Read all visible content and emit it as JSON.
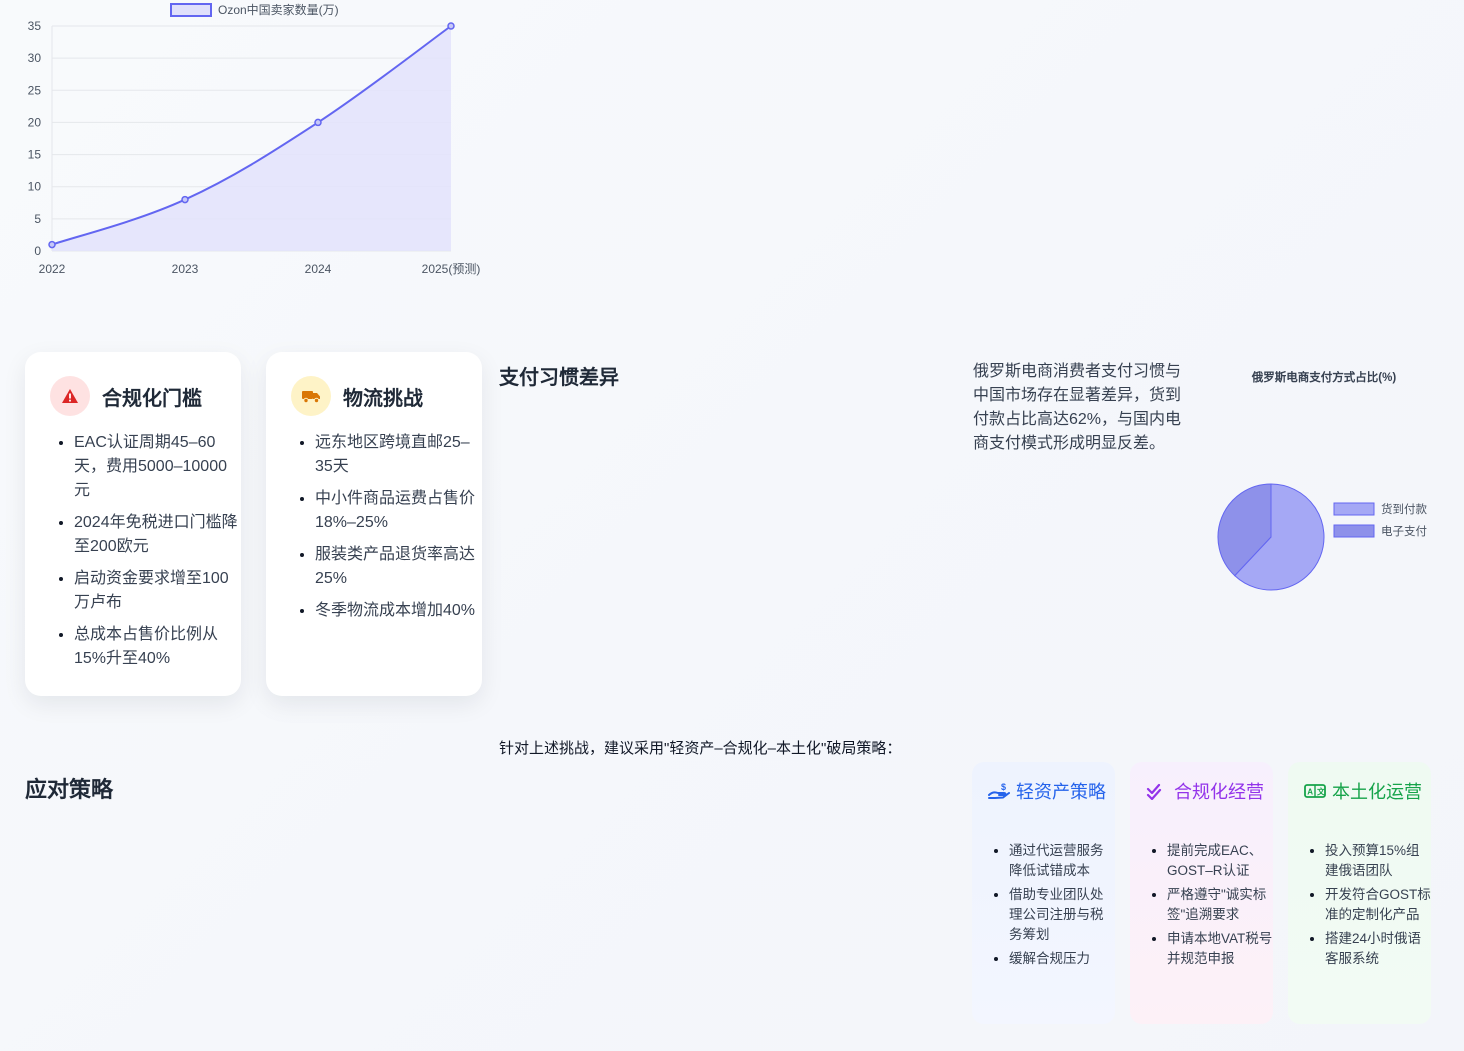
{
  "chart_data": [
    {
      "type": "area",
      "title": "",
      "xlabel": "",
      "ylabel": "",
      "legend": [
        "Ozon中国卖家数量(万)"
      ],
      "legend_placement": "top",
      "categories": [
        "2022",
        "2023",
        "2024",
        "2025(预测)"
      ],
      "series": [
        {
          "name": "Ozon中国卖家数量(万)",
          "values": [
            1,
            8,
            20,
            35
          ]
        }
      ],
      "ylim": [
        0,
        35
      ],
      "yticks": [
        0,
        5,
        10,
        15,
        20,
        25,
        30,
        35
      ],
      "grid": true,
      "colors": {
        "line": "#6366f1",
        "fill": "#e0e0fb"
      }
    },
    {
      "type": "pie",
      "title": "俄罗斯电商支付方式占比(%)",
      "labels": [
        "货到付款",
        "电子支付"
      ],
      "values": [
        62,
        38
      ],
      "legend_placement": "right",
      "colors": [
        "#a5a8f5",
        "#8e91ea"
      ]
    }
  ],
  "cards": [
    {
      "title": "合规化门槛",
      "icon": "warning-icon",
      "badge_color": "#fee2e2",
      "icon_color": "#dc2626",
      "items": [
        "EAC认证周期45–60天，费用5000–10000元",
        "2024年免税进口门槛降至200欧元",
        "启动资金要求增至100万卢布",
        "总成本占售价比例从15%升至40%"
      ]
    },
    {
      "title": "物流挑战",
      "icon": "truck-icon",
      "badge_color": "#fef3c7",
      "icon_color": "#d97706",
      "items": [
        "远东地区跨境直邮25–35天",
        "中小件商品运费占售价18%–25%",
        "服装类产品退货率高达25%",
        "冬季物流成本增加40%"
      ]
    }
  ],
  "payment": {
    "heading": "支付习惯差异",
    "description": "俄罗斯电商消费者支付习惯与中国市场存在显著差异，货到付款占比高达62%，与国内电商支付模式形成明显反差。"
  },
  "strategy": {
    "heading": "应对策略",
    "intro": "针对上述挑战，建议采用\"轻资产–合规化–本土化\"破局策略：",
    "cards": [
      {
        "title": "轻资产策略",
        "icon": "hand-coin-icon",
        "color": "#2563eb",
        "items": [
          "通过代运营服务降低试错成本",
          "借助专业团队处理公司注册与税务筹划",
          "缓解合规压力"
        ]
      },
      {
        "title": "合规化经营",
        "icon": "check-double-icon",
        "color": "#9333ea",
        "items": [
          "提前完成EAC、GOST–R认证",
          "严格遵守\"诚实标签\"追溯要求",
          "申请本地VAT税号并规范申报"
        ]
      },
      {
        "title": "本土化运营",
        "icon": "language-icon",
        "color": "#16a34a",
        "items": [
          "投入预算15%组建俄语团队",
          "开发符合GOST标准的定制化产品",
          "搭建24小时俄语客服系统"
        ]
      }
    ]
  }
}
